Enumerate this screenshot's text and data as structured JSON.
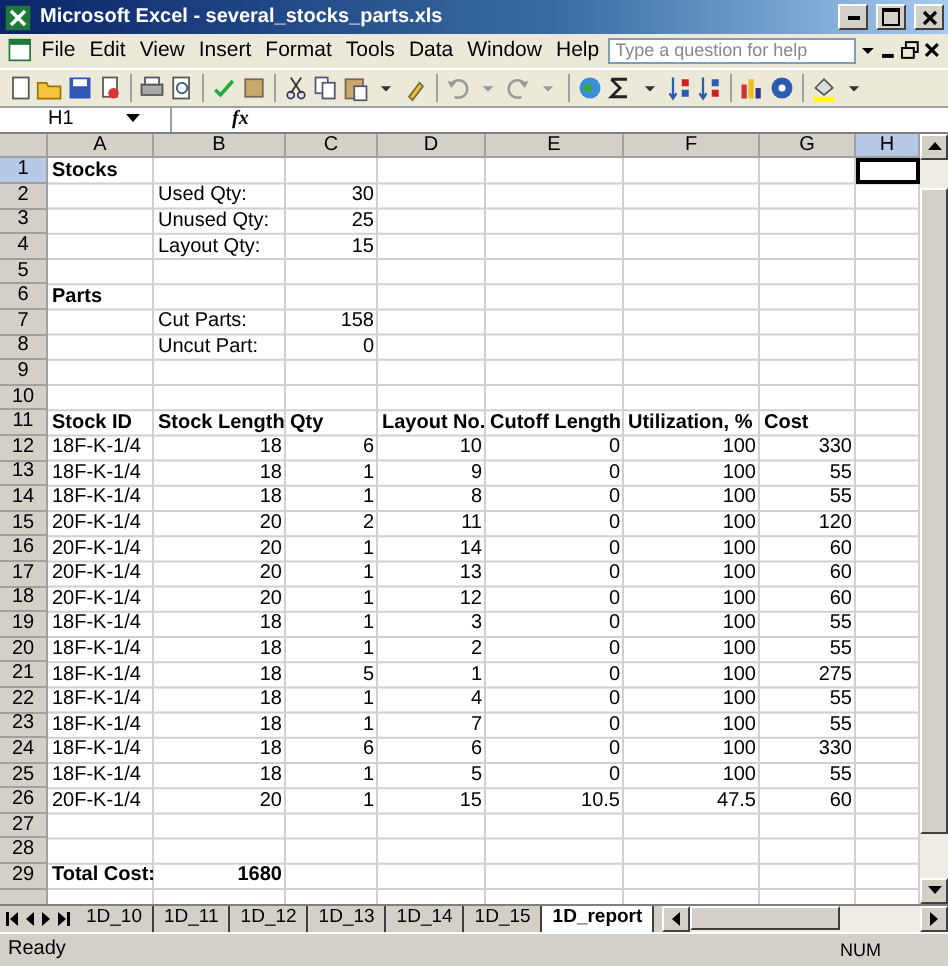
{
  "window": {
    "title": "Microsoft Excel - several_stocks_parts.xls"
  },
  "menu": [
    {
      "label": "File"
    },
    {
      "label": "Edit"
    },
    {
      "label": "View"
    },
    {
      "label": "Insert"
    },
    {
      "label": "Format"
    },
    {
      "label": "Tools"
    },
    {
      "label": "Data"
    },
    {
      "label": "Window"
    },
    {
      "label": "Help"
    }
  ],
  "help_box": {
    "placeholder": "Type a question for help"
  },
  "name_box": {
    "value": "H1"
  },
  "formula_bar": {
    "function_label": "fx"
  },
  "columns": [
    {
      "label": "A",
      "selected": false
    },
    {
      "label": "B",
      "selected": false
    },
    {
      "label": "C",
      "selected": false
    },
    {
      "label": "D",
      "selected": false
    },
    {
      "label": "E",
      "selected": false
    },
    {
      "label": "F",
      "selected": false
    },
    {
      "label": "G",
      "selected": false
    },
    {
      "label": "H",
      "selected": true
    }
  ],
  "rows": [
    {
      "number": "1",
      "selected": true,
      "cells": [
        {
          "text": "Stocks",
          "kind": "heading"
        }
      ]
    },
    {
      "number": "2",
      "selected": false,
      "cells": [
        {
          "kind": "empty"
        },
        {
          "text": "Used Qty:",
          "kind": "text"
        },
        {
          "text": "30",
          "kind": "number"
        }
      ]
    },
    {
      "number": "3",
      "selected": false,
      "cells": [
        {
          "kind": "empty"
        },
        {
          "text": "Unused Qty:",
          "kind": "text"
        },
        {
          "text": "25",
          "kind": "number"
        }
      ]
    },
    {
      "number": "4",
      "selected": false,
      "cells": [
        {
          "kind": "empty"
        },
        {
          "text": "Layout Qty:",
          "kind": "text"
        },
        {
          "text": "15",
          "kind": "number"
        }
      ]
    },
    {
      "number": "5",
      "selected": false,
      "cells": []
    },
    {
      "number": "6",
      "selected": false,
      "cells": [
        {
          "text": "Parts",
          "kind": "heading"
        }
      ]
    },
    {
      "number": "7",
      "selected": false,
      "cells": [
        {
          "kind": "empty"
        },
        {
          "text": "Cut Parts:",
          "kind": "text"
        },
        {
          "text": "158",
          "kind": "number"
        }
      ]
    },
    {
      "number": "8",
      "selected": false,
      "cells": [
        {
          "kind": "empty"
        },
        {
          "text": "Uncut Part:",
          "kind": "text"
        },
        {
          "text": "0",
          "kind": "number"
        }
      ]
    },
    {
      "number": "9",
      "selected": false,
      "cells": []
    },
    {
      "number": "10",
      "selected": false,
      "cells": []
    },
    {
      "number": "11",
      "selected": false,
      "cells": [
        {
          "text": "Stock ID",
          "kind": "heading"
        },
        {
          "text": "Stock Length",
          "kind": "heading"
        },
        {
          "text": "Qty",
          "kind": "heading"
        },
        {
          "text": "Layout No.",
          "kind": "heading"
        },
        {
          "text": "Cutoff Length",
          "kind": "heading"
        },
        {
          "text": "Utilization, %",
          "kind": "heading"
        },
        {
          "text": "Cost",
          "kind": "heading"
        }
      ]
    },
    {
      "number": "12",
      "selected": false,
      "cells": [
        {
          "text": "18F-K-1/4",
          "kind": "text"
        },
        {
          "text": "18",
          "kind": "number"
        },
        {
          "text": "6",
          "kind": "number"
        },
        {
          "text": "10",
          "kind": "number"
        },
        {
          "text": "0",
          "kind": "number"
        },
        {
          "text": "100",
          "kind": "number"
        },
        {
          "text": "330",
          "kind": "number"
        }
      ]
    },
    {
      "number": "13",
      "selected": false,
      "cells": [
        {
          "text": "18F-K-1/4",
          "kind": "text"
        },
        {
          "text": "18",
          "kind": "number"
        },
        {
          "text": "1",
          "kind": "number"
        },
        {
          "text": "9",
          "kind": "number"
        },
        {
          "text": "0",
          "kind": "number"
        },
        {
          "text": "100",
          "kind": "number"
        },
        {
          "text": "55",
          "kind": "number"
        }
      ]
    },
    {
      "number": "14",
      "selected": false,
      "cells": [
        {
          "text": "18F-K-1/4",
          "kind": "text"
        },
        {
          "text": "18",
          "kind": "number"
        },
        {
          "text": "1",
          "kind": "number"
        },
        {
          "text": "8",
          "kind": "number"
        },
        {
          "text": "0",
          "kind": "number"
        },
        {
          "text": "100",
          "kind": "number"
        },
        {
          "text": "55",
          "kind": "number"
        }
      ]
    },
    {
      "number": "15",
      "selected": false,
      "cells": [
        {
          "text": "20F-K-1/4",
          "kind": "text"
        },
        {
          "text": "20",
          "kind": "number"
        },
        {
          "text": "2",
          "kind": "number"
        },
        {
          "text": "11",
          "kind": "number"
        },
        {
          "text": "0",
          "kind": "number"
        },
        {
          "text": "100",
          "kind": "number"
        },
        {
          "text": "120",
          "kind": "number"
        }
      ]
    },
    {
      "number": "16",
      "selected": false,
      "cells": [
        {
          "text": "20F-K-1/4",
          "kind": "text"
        },
        {
          "text": "20",
          "kind": "number"
        },
        {
          "text": "1",
          "kind": "number"
        },
        {
          "text": "14",
          "kind": "number"
        },
        {
          "text": "0",
          "kind": "number"
        },
        {
          "text": "100",
          "kind": "number"
        },
        {
          "text": "60",
          "kind": "number"
        }
      ]
    },
    {
      "number": "17",
      "selected": false,
      "cells": [
        {
          "text": "20F-K-1/4",
          "kind": "text"
        },
        {
          "text": "20",
          "kind": "number"
        },
        {
          "text": "1",
          "kind": "number"
        },
        {
          "text": "13",
          "kind": "number"
        },
        {
          "text": "0",
          "kind": "number"
        },
        {
          "text": "100",
          "kind": "number"
        },
        {
          "text": "60",
          "kind": "number"
        }
      ]
    },
    {
      "number": "18",
      "selected": false,
      "cells": [
        {
          "text": "20F-K-1/4",
          "kind": "text"
        },
        {
          "text": "20",
          "kind": "number"
        },
        {
          "text": "1",
          "kind": "number"
        },
        {
          "text": "12",
          "kind": "number"
        },
        {
          "text": "0",
          "kind": "number"
        },
        {
          "text": "100",
          "kind": "number"
        },
        {
          "text": "60",
          "kind": "number"
        }
      ]
    },
    {
      "number": "19",
      "selected": false,
      "cells": [
        {
          "text": "18F-K-1/4",
          "kind": "text"
        },
        {
          "text": "18",
          "kind": "number"
        },
        {
          "text": "1",
          "kind": "number"
        },
        {
          "text": "3",
          "kind": "number"
        },
        {
          "text": "0",
          "kind": "number"
        },
        {
          "text": "100",
          "kind": "number"
        },
        {
          "text": "55",
          "kind": "number"
        }
      ]
    },
    {
      "number": "20",
      "selected": false,
      "cells": [
        {
          "text": "18F-K-1/4",
          "kind": "text"
        },
        {
          "text": "18",
          "kind": "number"
        },
        {
          "text": "1",
          "kind": "number"
        },
        {
          "text": "2",
          "kind": "number"
        },
        {
          "text": "0",
          "kind": "number"
        },
        {
          "text": "100",
          "kind": "number"
        },
        {
          "text": "55",
          "kind": "number"
        }
      ]
    },
    {
      "number": "21",
      "selected": false,
      "cells": [
        {
          "text": "18F-K-1/4",
          "kind": "text"
        },
        {
          "text": "18",
          "kind": "number"
        },
        {
          "text": "5",
          "kind": "number"
        },
        {
          "text": "1",
          "kind": "number"
        },
        {
          "text": "0",
          "kind": "number"
        },
        {
          "text": "100",
          "kind": "number"
        },
        {
          "text": "275",
          "kind": "number"
        }
      ]
    },
    {
      "number": "22",
      "selected": false,
      "cells": [
        {
          "text": "18F-K-1/4",
          "kind": "text"
        },
        {
          "text": "18",
          "kind": "number"
        },
        {
          "text": "1",
          "kind": "number"
        },
        {
          "text": "4",
          "kind": "number"
        },
        {
          "text": "0",
          "kind": "number"
        },
        {
          "text": "100",
          "kind": "number"
        },
        {
          "text": "55",
          "kind": "number"
        }
      ]
    },
    {
      "number": "23",
      "selected": false,
      "cells": [
        {
          "text": "18F-K-1/4",
          "kind": "text"
        },
        {
          "text": "18",
          "kind": "number"
        },
        {
          "text": "1",
          "kind": "number"
        },
        {
          "text": "7",
          "kind": "number"
        },
        {
          "text": "0",
          "kind": "number"
        },
        {
          "text": "100",
          "kind": "number"
        },
        {
          "text": "55",
          "kind": "number"
        }
      ]
    },
    {
      "number": "24",
      "selected": false,
      "cells": [
        {
          "text": "18F-K-1/4",
          "kind": "text"
        },
        {
          "text": "18",
          "kind": "number"
        },
        {
          "text": "6",
          "kind": "number"
        },
        {
          "text": "6",
          "kind": "number"
        },
        {
          "text": "0",
          "kind": "number"
        },
        {
          "text": "100",
          "kind": "number"
        },
        {
          "text": "330",
          "kind": "number"
        }
      ]
    },
    {
      "number": "25",
      "selected": false,
      "cells": [
        {
          "text": "18F-K-1/4",
          "kind": "text"
        },
        {
          "text": "18",
          "kind": "number"
        },
        {
          "text": "1",
          "kind": "number"
        },
        {
          "text": "5",
          "kind": "number"
        },
        {
          "text": "0",
          "kind": "number"
        },
        {
          "text": "100",
          "kind": "number"
        },
        {
          "text": "55",
          "kind": "number"
        }
      ]
    },
    {
      "number": "26",
      "selected": false,
      "cells": [
        {
          "text": "20F-K-1/4",
          "kind": "text"
        },
        {
          "text": "20",
          "kind": "number"
        },
        {
          "text": "1",
          "kind": "number"
        },
        {
          "text": "15",
          "kind": "number"
        },
        {
          "text": "10.5",
          "kind": "number"
        },
        {
          "text": "47.5",
          "kind": "number"
        },
        {
          "text": "60",
          "kind": "number"
        }
      ]
    },
    {
      "number": "27",
      "selected": false,
      "cells": []
    },
    {
      "number": "28",
      "selected": false,
      "cells": []
    },
    {
      "number": "29",
      "selected": false,
      "cells": [
        {
          "text": "Total Cost:",
          "kind": "heading"
        },
        {
          "text": "1680",
          "kind": "total"
        }
      ]
    }
  ],
  "sheet_tabs": [
    {
      "label": "1D_10",
      "selected": false
    },
    {
      "label": "1D_11",
      "selected": false
    },
    {
      "label": "1D_12",
      "selected": false
    },
    {
      "label": "1D_13",
      "selected": false
    },
    {
      "label": "1D_14",
      "selected": false
    },
    {
      "label": "1D_15",
      "selected": false
    },
    {
      "label": "1D_report",
      "selected": true
    }
  ],
  "status_bar": {
    "text": "Ready",
    "indicator": "NUM"
  }
}
